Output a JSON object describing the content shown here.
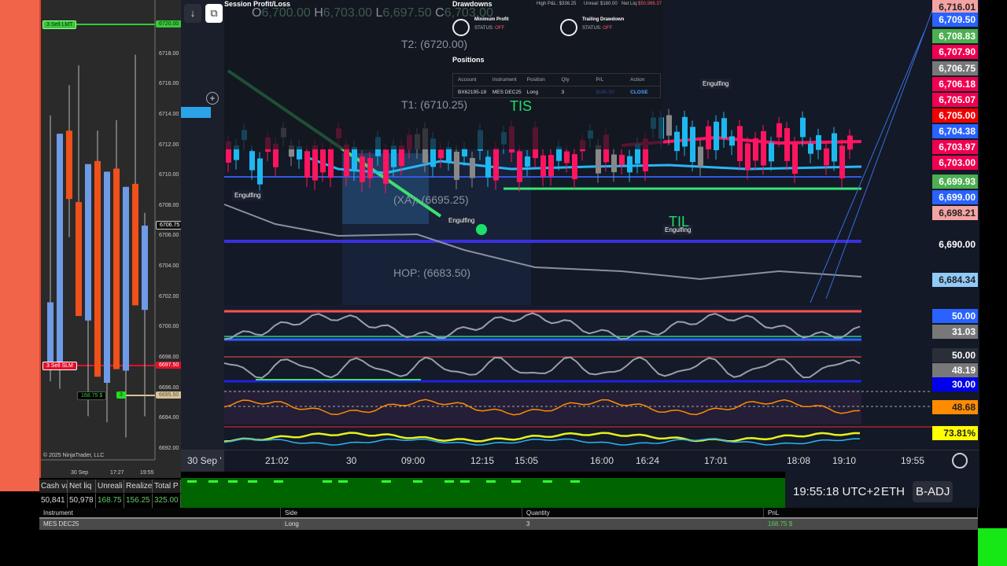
{
  "left_chart": {
    "order_top": {
      "label": "3 Sell LMT",
      "price": "6720.00"
    },
    "order_bottom": {
      "label": "3 Sell SLM",
      "price": "6697.50"
    },
    "position": {
      "pnl": "168.75 $",
      "qty": "3",
      "price": "6695.50"
    },
    "last_price": "6706.75",
    "axis": [
      "6718.00",
      "6716.00",
      "6714.00",
      "6712.00",
      "6710.00",
      "6708.00",
      "6706.00",
      "6704.00",
      "6702.00",
      "6700.00",
      "6698.00",
      "6696.00",
      "6694.00",
      "6692.00"
    ],
    "time_labels": [
      "30 Sep",
      "17:27",
      "19:55"
    ],
    "copyright": "© 2025 NinjaTrader, LLC",
    "candles": [
      {
        "o": 6697.5,
        "h": 6714,
        "l": 6696.5,
        "c": 6701.7
      },
      {
        "o": 6697.5,
        "h": 6712.8,
        "l": 6696,
        "c": 6712.8
      },
      {
        "o": 6713,
        "h": 6716,
        "l": 6706,
        "c": 6708.5
      },
      {
        "o": 6708.3,
        "h": 6717.3,
        "l": 6700.8,
        "c": 6700.8
      },
      {
        "o": 6700.5,
        "h": 6710.8,
        "l": 6694.2,
        "c": 6710.8
      },
      {
        "o": 6711,
        "h": 6713,
        "l": 6696.8,
        "c": 6696.8
      },
      {
        "o": 6696.4,
        "h": 6710.3,
        "l": 6693.8,
        "c": 6710.3
      },
      {
        "o": 6710.5,
        "h": 6713.7,
        "l": 6697.3,
        "c": 6697.3
      },
      {
        "o": 6697.2,
        "h": 6709.3,
        "l": 6692.8,
        "c": 6709.3
      },
      {
        "o": 6709.5,
        "h": 6718,
        "l": 6701.5,
        "c": 6701.5
      },
      {
        "o": 6701.2,
        "h": 6707.6,
        "l": 6694.2,
        "c": 6706.75
      }
    ],
    "up_color": "#6e9be8",
    "down_color": "#f0501a"
  },
  "account": {
    "headers": [
      "Cash va",
      "Net liq",
      "Unreali",
      "Realize",
      "Total P"
    ],
    "values": [
      "50,841",
      "50,978",
      "168.75",
      "156.25",
      "325.00"
    ]
  },
  "positions_table": {
    "headers": [
      "Instrument",
      "Side",
      "Quantity",
      "PnL"
    ],
    "row": [
      "MES DEC25",
      "Long",
      "3",
      "168.75 $"
    ]
  },
  "overlay": {
    "title": "Session Profit/Loss",
    "ohlc": {
      "o": "6,700.00",
      "h": "6,703.00",
      "l": "6,697.50",
      "c": "6,703.00"
    },
    "drawdowns": "Drawdowns",
    "high_pnl": "High P&L: $336.25",
    "unreal": "Unreal: $180.00",
    "net_liq_label": "Net Liq:",
    "net_liq": "$50,986.37",
    "min_profit": "Minimum Profit",
    "trailing": "Trailing Drawdown",
    "status_label": "STATUS:",
    "status": "OFF",
    "positions": "Positions",
    "table_headers": [
      "Account",
      "Instrument",
      "Position",
      "Qty",
      "P/L",
      "Action"
    ],
    "table_row": [
      "BX62195-18",
      "MES DEC25",
      "Long",
      "3",
      "$180.00",
      "CLOSE"
    ]
  },
  "annotations": {
    "t2": "T2: (6720.00)",
    "t1": "T1: (6710.25)",
    "xa": "(XA): (6695.25)",
    "hop": "HOP: (6683.50)",
    "engulfing": "Engulfing",
    "tis": "TIS",
    "til": "TIL"
  },
  "price_scale": [
    {
      "v": "6,716.01",
      "bg": "#f4a3a3",
      "fg": "#222"
    },
    {
      "v": "6,709.50",
      "bg": "#2962ff",
      "fg": "#fff"
    },
    {
      "v": "6,708.83",
      "bg": "#4caf50",
      "fg": "#fff"
    },
    {
      "v": "6,707.90",
      "bg": "#f00050",
      "fg": "#fff"
    },
    {
      "v": "6,706.75",
      "bg": "#787878",
      "fg": "#fff"
    },
    {
      "v": "6,706.18",
      "bg": "#f00050",
      "fg": "#fff"
    },
    {
      "v": "6,705.07",
      "bg": "#f00050",
      "fg": "#fff"
    },
    {
      "v": "6,705.00",
      "bg": "#f00000",
      "fg": "#fff"
    },
    {
      "v": "6,704.38",
      "bg": "#2962ff",
      "fg": "#fff"
    },
    {
      "v": "6,703.97",
      "bg": "#f00050",
      "fg": "#fff"
    },
    {
      "v": "6,703.00",
      "bg": "#f00050",
      "fg": "#fff"
    },
    {
      "v": "6,699.93",
      "bg": "#4caf50",
      "fg": "#fff"
    },
    {
      "v": "6,699.00",
      "bg": "#2962ff",
      "fg": "#fff"
    },
    {
      "v": "6,698.21",
      "bg": "#f4a3a3",
      "fg": "#222"
    },
    {
      "v": "6,690.00",
      "bg": "transparent",
      "fg": "#fff"
    },
    {
      "v": "6,684.34",
      "bg": "#90caf9",
      "fg": "#222"
    }
  ],
  "indicator_scale": [
    {
      "v": "50.00",
      "bg": "#2962ff",
      "fg": "#fff"
    },
    {
      "v": "31.03",
      "bg": "#787878",
      "fg": "#fff"
    },
    {
      "v": "50.00",
      "bg": "#2a2e39",
      "fg": "#fff"
    },
    {
      "v": "48.19",
      "bg": "#787878",
      "fg": "#fff"
    },
    {
      "v": "30.00",
      "bg": "#0000ee",
      "fg": "#fff"
    },
    {
      "v": "48.68",
      "bg": "#ff8c00",
      "fg": "#222"
    },
    {
      "v": "73.81%",
      "bg": "#ffff00",
      "fg": "#222"
    }
  ],
  "time_axis": {
    "first": "30 Sep '",
    "labels": [
      "21:02",
      "30",
      "09:00",
      "12:15",
      "15:05",
      "16:00",
      "16:24",
      "17:01",
      "18:08",
      "19:10",
      "19:55"
    ]
  },
  "status_bar": {
    "time": "19:55:18 UTC+2",
    "session": "ETH",
    "adj": "B-ADJ"
  },
  "logo": "TV"
}
